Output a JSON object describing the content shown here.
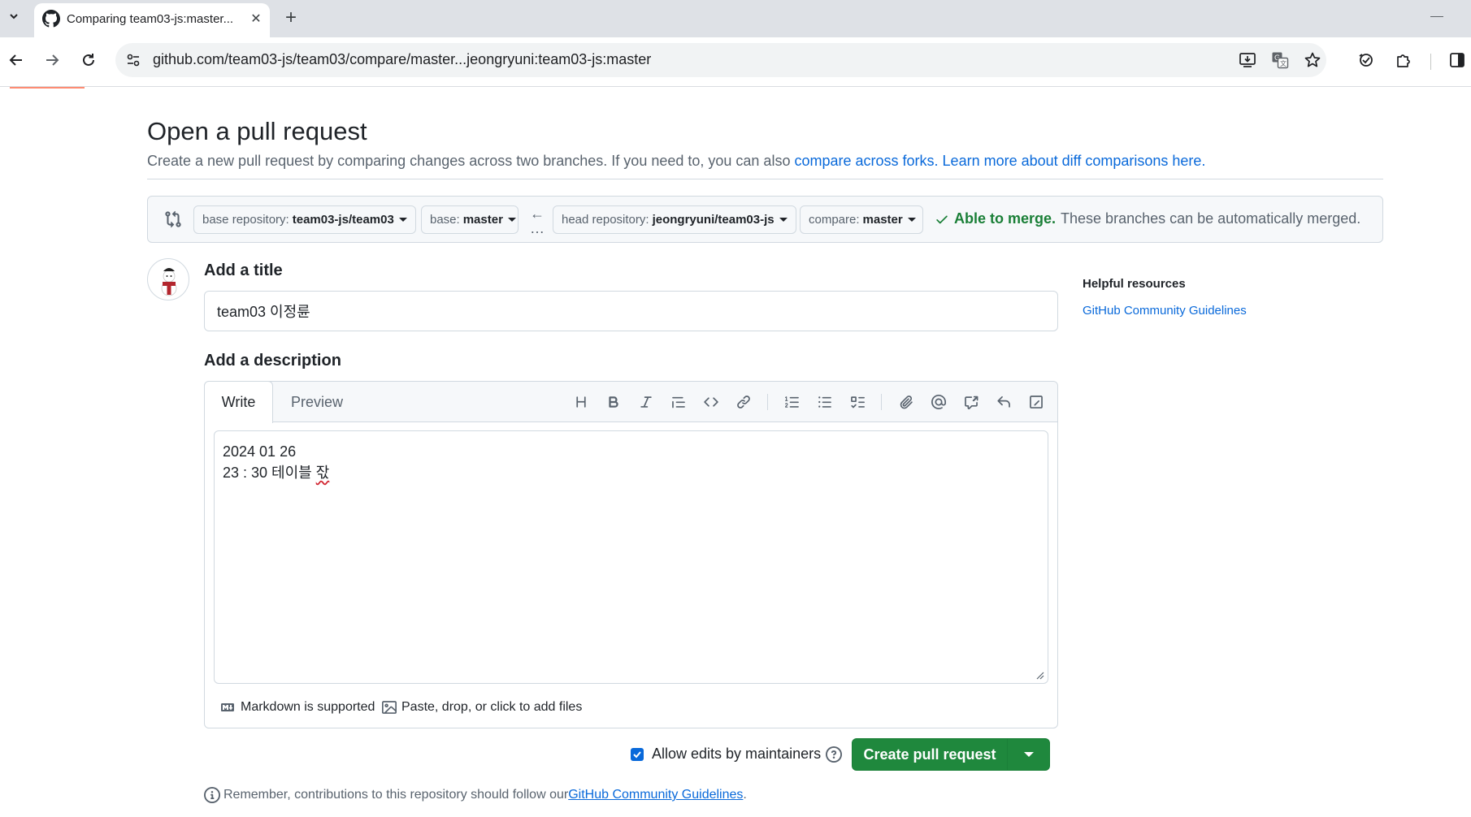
{
  "browser": {
    "tab_title": "Comparing team03-js:master...",
    "url": "github.com/team03-js/team03/compare/master...jeongryuni:team03-js:master"
  },
  "page": {
    "heading": "Open a pull request",
    "subhead_text": "Create a new pull request by comparing changes across two branches. If you need to, you can also ",
    "subhead_link_forks": "compare across forks.",
    "subhead_link_learn": "Learn more about diff comparisons here."
  },
  "compare": {
    "base_repo_label": "base repository:",
    "base_repo_value": "team03-js/team03",
    "base_label": "base:",
    "base_value": "master",
    "head_repo_label": "head repository:",
    "head_repo_value": "jeongryuni/team03-js",
    "compare_label": "compare:",
    "compare_value": "master",
    "merge_ok": "Able to merge.",
    "merge_msg": "These branches can be automatically merged."
  },
  "form": {
    "title_label": "Add a title",
    "title_value": "team03 이정륜",
    "description_label": "Add a description",
    "tab_write": "Write",
    "tab_preview": "Preview",
    "description_line1": "2024 01 26",
    "description_line2_prefix": "23 : 30 테이블 ",
    "description_line2_squiggle": "잓",
    "markdown_note": "Markdown is supported",
    "attach_note": "Paste, drop, or click to add files",
    "allow_edits": "Allow edits by maintainers",
    "allow_edits_checked": true,
    "create_button": "Create pull request"
  },
  "footer": {
    "remember_text": "Remember, contributions to this repository should follow our ",
    "remember_link": "GitHub Community Guidelines",
    "remember_end": "."
  },
  "sidebar": {
    "title": "Helpful resources",
    "link": "GitHub Community Guidelines"
  },
  "colors": {
    "accent": "#0969da",
    "success": "#1a7f37",
    "primary_button": "#1f883d"
  }
}
